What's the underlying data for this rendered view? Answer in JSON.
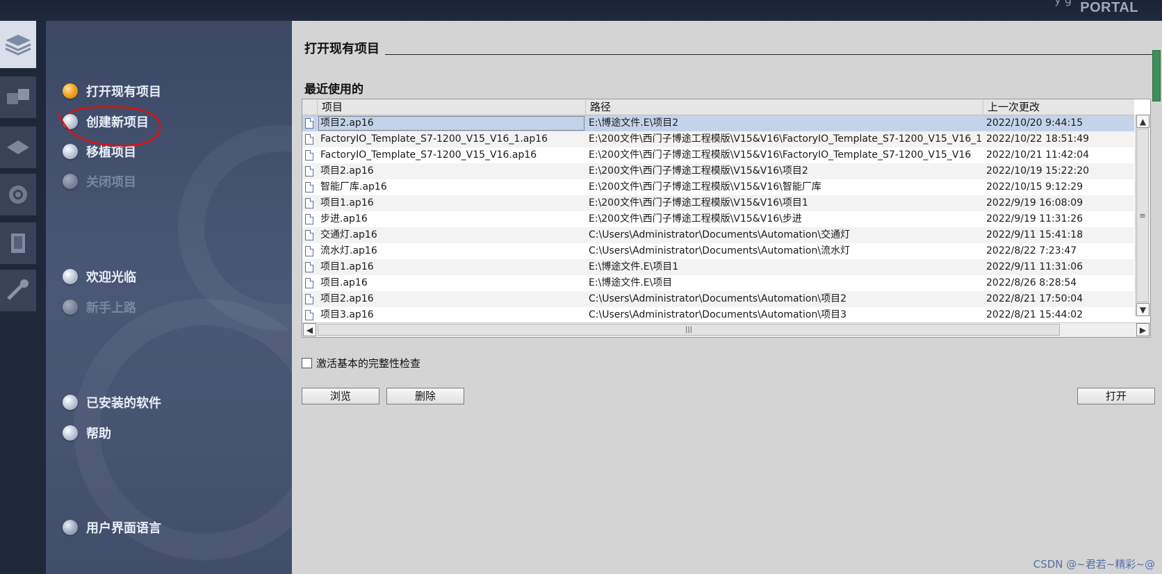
{
  "header": {
    "brand": "PORTAL",
    "top_cut_text": "y g"
  },
  "nav": {
    "items": [
      {
        "label": "打开现有项目",
        "state": "active"
      },
      {
        "label": "创建新项目",
        "state": "normal"
      },
      {
        "label": "移植项目",
        "state": "normal"
      },
      {
        "label": "关闭项目",
        "state": "disabled"
      },
      {
        "label": "欢迎光临",
        "state": "normal"
      },
      {
        "label": "新手上路",
        "state": "disabled"
      },
      {
        "label": "已安装的软件",
        "state": "normal"
      },
      {
        "label": "帮助",
        "state": "normal"
      },
      {
        "label": "用户界面语言",
        "state": "normal"
      }
    ]
  },
  "main": {
    "title": "打开现有项目",
    "recent_heading": "最近使用的",
    "columns": {
      "project": "项目",
      "path": "路径",
      "modified": "上一次更改"
    },
    "rows": [
      {
        "project": "项目2.ap16",
        "path": "E:\\博途文件.E\\项目2",
        "modified": "2022/10/20 9:44:15"
      },
      {
        "project": "FactoryIO_Template_S7-1200_V15_V16_1.ap16",
        "path": "E:\\200文件\\西门子博途工程模版\\V15&V16\\FactoryIO_Template_S7-1200_V15_V16_1",
        "modified": "2022/10/22 18:51:49"
      },
      {
        "project": "FactoryIO_Template_S7-1200_V15_V16.ap16",
        "path": "E:\\200文件\\西门子博途工程模版\\V15&V16\\FactoryIO_Template_S7-1200_V15_V16",
        "modified": "2022/10/21 11:42:04"
      },
      {
        "project": "项目2.ap16",
        "path": "E:\\200文件\\西门子博途工程模版\\V15&V16\\项目2",
        "modified": "2022/10/19 15:22:20"
      },
      {
        "project": "智能厂库.ap16",
        "path": "E:\\200文件\\西门子博途工程模版\\V15&V16\\智能厂库",
        "modified": "2022/10/15 9:12:29"
      },
      {
        "project": "项目1.ap16",
        "path": "E:\\200文件\\西门子博途工程模版\\V15&V16\\项目1",
        "modified": "2022/9/19 16:08:09"
      },
      {
        "project": "步进.ap16",
        "path": "E:\\200文件\\西门子博途工程模版\\V15&V16\\步进",
        "modified": "2022/9/19 11:31:26"
      },
      {
        "project": "交通灯.ap16",
        "path": "C:\\Users\\Administrator\\Documents\\Automation\\交通灯",
        "modified": "2022/9/11 15:41:18"
      },
      {
        "project": "流水灯.ap16",
        "path": "C:\\Users\\Administrator\\Documents\\Automation\\流水灯",
        "modified": "2022/8/22 7:23:47"
      },
      {
        "project": "项目1.ap16",
        "path": "E:\\博途文件.E\\项目1",
        "modified": "2022/9/11 11:31:06"
      },
      {
        "project": "项目.ap16",
        "path": "E:\\博途文件.E\\项目",
        "modified": "2022/8/26 8:28:54"
      },
      {
        "project": "项目2.ap16",
        "path": "C:\\Users\\Administrator\\Documents\\Automation\\项目2",
        "modified": "2022/8/21 17:50:04"
      },
      {
        "project": "项目3.ap16",
        "path": "C:\\Users\\Administrator\\Documents\\Automation\\项目3",
        "modified": "2022/8/21 15:44:02"
      }
    ],
    "checkbox_label": "激活基本的完整性检查",
    "buttons": {
      "browse": "浏览",
      "delete": "删除",
      "open": "打开"
    }
  },
  "watermark": "CSDN @~君若~精彩~@",
  "colors": {
    "accent_active": "#f5a623",
    "selection": "#c5d3ea",
    "annotation": "#e01010"
  }
}
